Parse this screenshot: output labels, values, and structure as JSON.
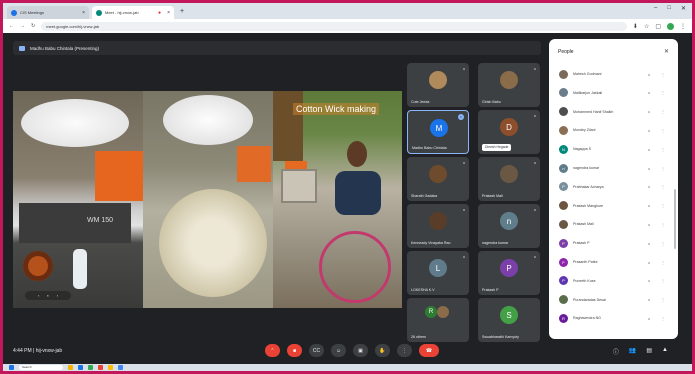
{
  "browser": {
    "tabs": [
      {
        "label": "CIS Meetings",
        "icon_color": "#1a73e8"
      },
      {
        "label": "Meet - hij-vnxw-jab",
        "icon_color": "#00897b"
      }
    ],
    "url": "meet.google.com/hij-vnxw-jab"
  },
  "meet": {
    "presenting_label": "Madhu Babu Chintala (Presenting)",
    "caption": "Cotton Wick making",
    "meeting_time": "4:44 PM",
    "meeting_code": "hij-vnxw-jab",
    "tiles": [
      {
        "name": "Cute Jeeda",
        "initial": "",
        "color": "#b08a5a"
      },
      {
        "name": "Girish Babu",
        "initial": "",
        "color": "#8a6b4a"
      },
      {
        "name": "Madhu Babu Chintala",
        "initial": "M",
        "color": "#1a73e8"
      },
      {
        "name": "Dinesh Hegade",
        "initial": "D",
        "color": "#8d4e2c"
      },
      {
        "name": "Sharath Gadaka",
        "initial": "",
        "color": "#6e4b2d"
      },
      {
        "name": "Prakash Mali",
        "initial": "",
        "color": "#6b5844"
      },
      {
        "name": "Kenneady Vinayaka Rao",
        "initial": "",
        "color": "#5a3d28"
      },
      {
        "name": "nagendra kumar",
        "initial": "n",
        "color": "#607d8b"
      },
      {
        "name": "LOKESHA K.V",
        "initial": "L",
        "color": "#5f7b8c"
      },
      {
        "name": "Prakash P",
        "initial": "P",
        "color": "#7b3fa8"
      },
      {
        "name": "26 others",
        "initial": "R",
        "color": "#2e7d32"
      },
      {
        "name": "Swuabharathi Kamyoty",
        "initial": "S",
        "color": "#43a047"
      }
    ]
  },
  "people_panel": {
    "title": "People",
    "participants": [
      {
        "name": "Mahesh Godmani",
        "initial": "",
        "color": "#7a6a5a"
      },
      {
        "name": "Mallikarjun Jakkali",
        "initial": "",
        "color": "#6b7c8a"
      },
      {
        "name": "Mohammed Hanif Shaikh",
        "initial": "",
        "color": "#4e4e4e"
      },
      {
        "name": "Mundey Zilani",
        "initial": "",
        "color": "#8a6f55"
      },
      {
        "name": "Nagappa S",
        "initial": "N",
        "color": "#00897b"
      },
      {
        "name": "nagendra kumar",
        "initial": "n",
        "color": "#607d8b"
      },
      {
        "name": "Prabhakar Acharya",
        "initial": "P",
        "color": "#78909c"
      },
      {
        "name": "Prakash Mangkure",
        "initial": "",
        "color": "#6e5540"
      },
      {
        "name": "Prakash Mali",
        "initial": "",
        "color": "#6b5844"
      },
      {
        "name": "Prakash P",
        "initial": "P",
        "color": "#7b3fa8"
      },
      {
        "name": "Prasanth Patke",
        "initial": "P",
        "color": "#8e24aa"
      },
      {
        "name": "Puneeth Kuse",
        "initial": "P",
        "color": "#5e35b1"
      },
      {
        "name": "Purandaradas Desai",
        "initial": "",
        "color": "#5b6e4b"
      },
      {
        "name": "Raghavendra NG",
        "initial": "R",
        "color": "#6a1b9a"
      }
    ]
  },
  "taskbar": {
    "search_label": "Search"
  }
}
